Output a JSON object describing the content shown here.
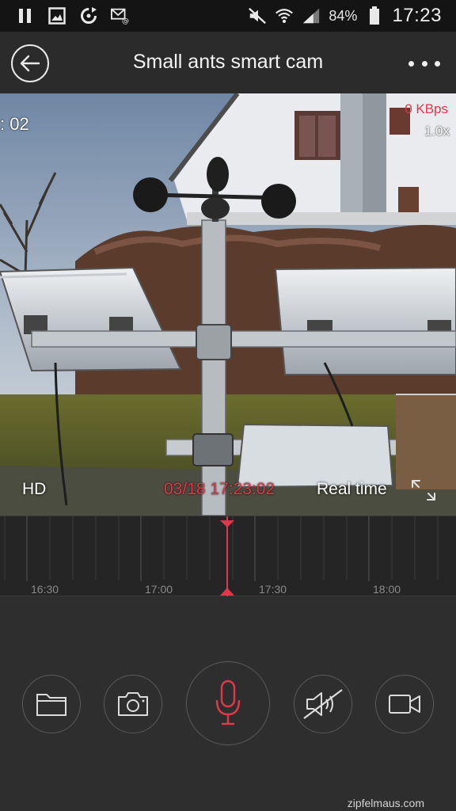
{
  "status_bar": {
    "icons_left": [
      "pause-icon",
      "image-icon",
      "sync-icon",
      "mail-icon"
    ],
    "icons_right": [
      "mute-icon",
      "wifi-icon",
      "signal-icon",
      "battery-icon"
    ],
    "battery": "84%",
    "time": "17:23"
  },
  "app_bar": {
    "back_icon": "back-arrow-icon",
    "title": "Small ants smart cam",
    "more_icon": "more-dots-icon"
  },
  "camera": {
    "left_overlay": ": 02",
    "kbps": "0 KBps",
    "zoom": "1.0x",
    "quality": "HD",
    "timestamp": "03/18 17:23:02",
    "mode": "Real time",
    "fullscreen_icon": "expand-icon",
    "timestamp_color": "#ea3447"
  },
  "timeline": {
    "labels": [
      "16:30",
      "17:00",
      "17:30",
      "18:00"
    ],
    "cursor_color": "#e0384a"
  },
  "controls": {
    "buttons": [
      "folder-icon",
      "camera-icon",
      "microphone-icon",
      "speaker-muted-icon",
      "video-camera-icon"
    ],
    "mic_color": "#e0384a"
  },
  "watermark": "zipfelmaus.com"
}
